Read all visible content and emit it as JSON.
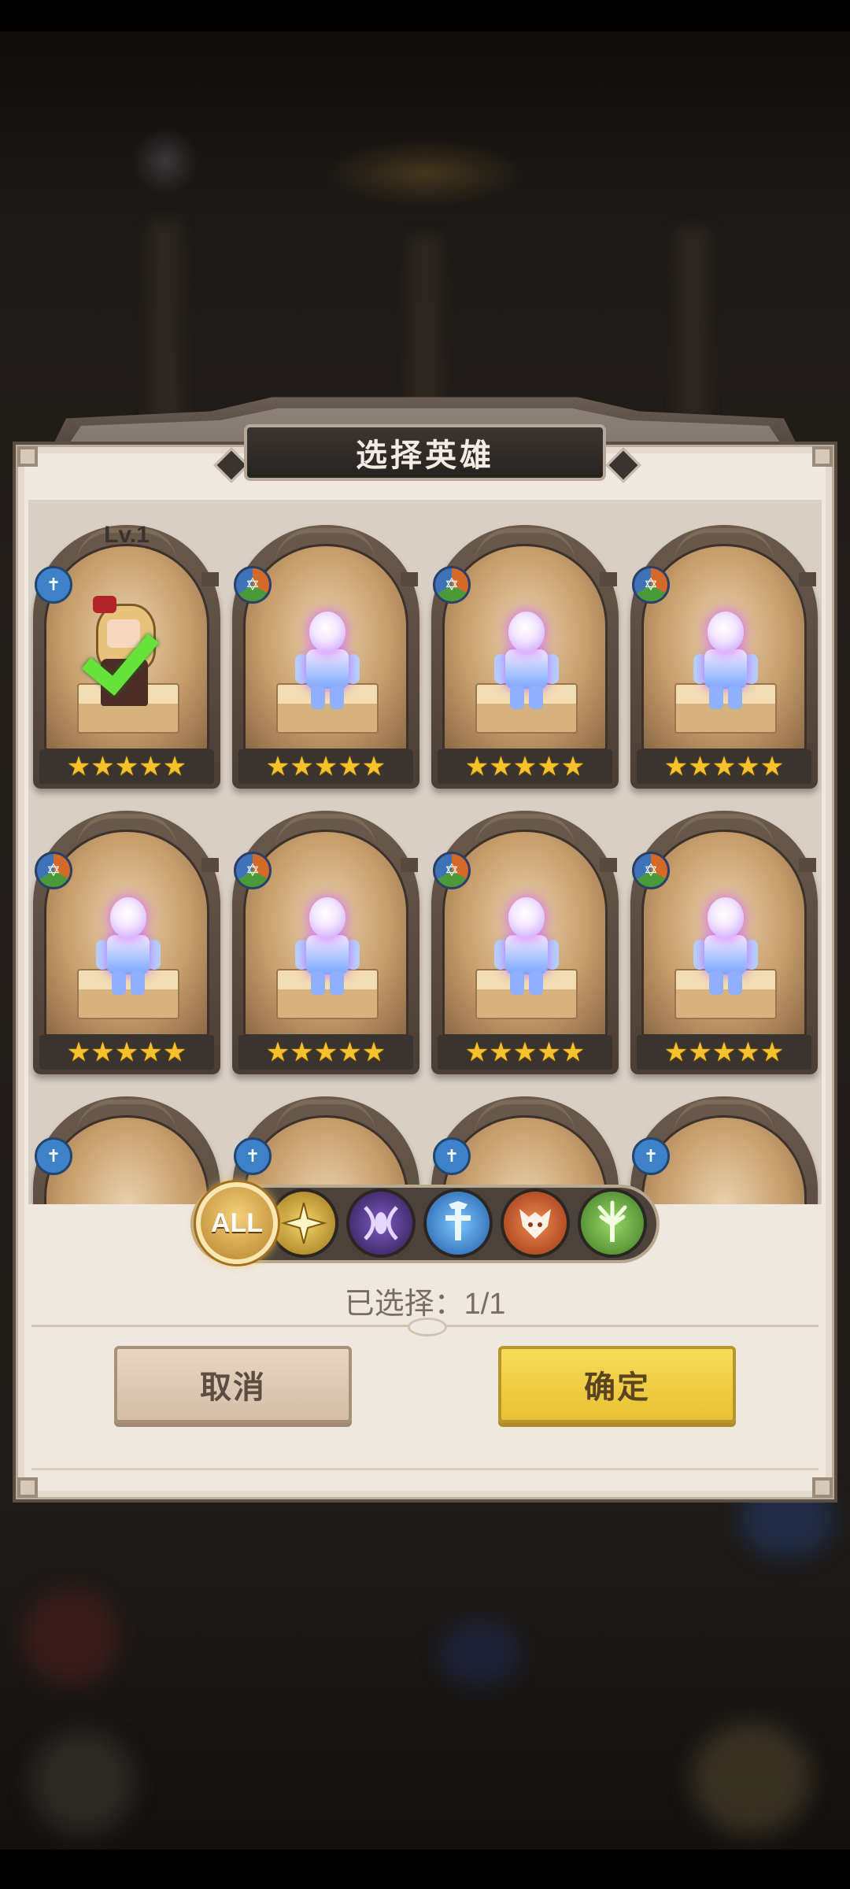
{
  "dialog": {
    "title": "选择英雄",
    "selected_label": "已选择：1/1",
    "cancel_label": "取消",
    "confirm_label": "确定"
  },
  "filters": [
    {
      "name": "all",
      "label": "ALL",
      "icon": "all-icon",
      "active": true
    },
    {
      "name": "light",
      "icon": "light-faction-icon"
    },
    {
      "name": "dark",
      "icon": "dark-faction-icon"
    },
    {
      "name": "human",
      "icon": "human-faction-icon"
    },
    {
      "name": "beast",
      "icon": "beast-faction-icon"
    },
    {
      "name": "nature",
      "icon": "nature-faction-icon"
    }
  ],
  "heroes": [
    {
      "level": "Lv.1",
      "stars": "★★★★★",
      "selected": true,
      "faction": "blue",
      "portrait": "archer-girl"
    },
    {
      "stars": "★★★★★",
      "faction": "tri",
      "portrait": "mystery-silhouette"
    },
    {
      "stars": "★★★★★",
      "faction": "tri",
      "portrait": "mystery-silhouette"
    },
    {
      "stars": "★★★★★",
      "faction": "tri",
      "portrait": "mystery-silhouette"
    },
    {
      "stars": "★★★★★",
      "faction": "tri",
      "portrait": "mystery-silhouette"
    },
    {
      "stars": "★★★★★",
      "faction": "tri",
      "portrait": "mystery-silhouette"
    },
    {
      "stars": "★★★★★",
      "faction": "tri",
      "portrait": "mystery-silhouette"
    },
    {
      "stars": "★★★★★",
      "faction": "tri",
      "portrait": "mystery-silhouette"
    }
  ],
  "colors": {
    "confirm": "#eac033",
    "cancel": "#d4bea6",
    "star": "#f5c22e",
    "check": "#67e23a"
  }
}
